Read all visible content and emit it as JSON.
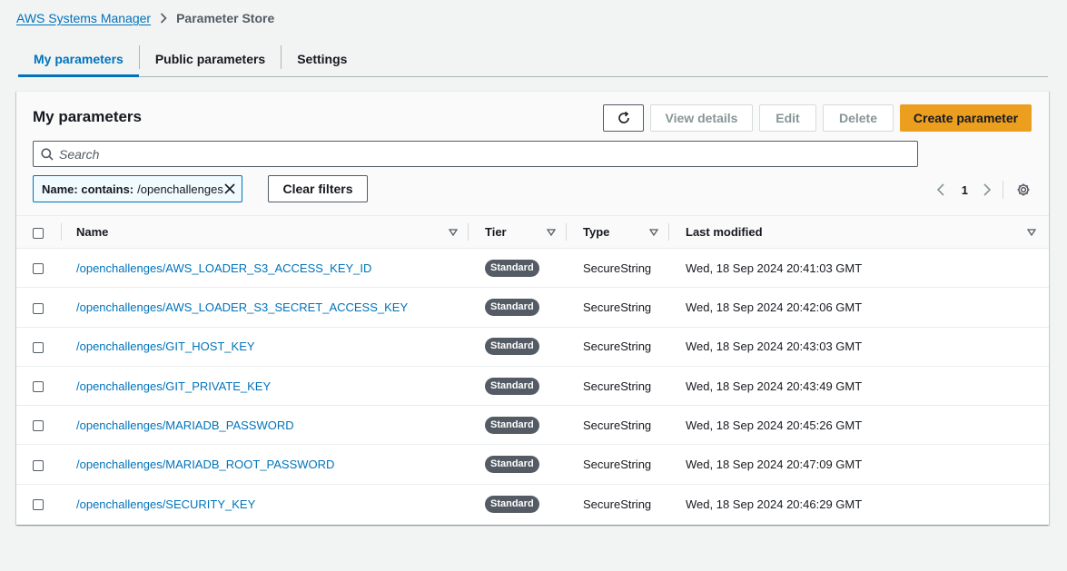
{
  "breadcrumb": {
    "parent": "AWS Systems Manager",
    "current": "Parameter Store"
  },
  "tabs": [
    {
      "label": "My parameters",
      "active": true
    },
    {
      "label": "Public parameters",
      "active": false
    },
    {
      "label": "Settings",
      "active": false
    }
  ],
  "panel": {
    "title": "My parameters",
    "buttons": {
      "refresh_icon": "refresh-icon",
      "view_details": "View details",
      "edit": "Edit",
      "delete": "Delete",
      "create": "Create parameter"
    },
    "search": {
      "placeholder": "Search",
      "value": ""
    },
    "filter_token": {
      "key": "Name: contains:",
      "value": "/openchallenges"
    },
    "clear_filters": "Clear filters",
    "pager": {
      "page": "1"
    }
  },
  "table": {
    "columns": [
      "Name",
      "Tier",
      "Type",
      "Last modified"
    ],
    "rows": [
      {
        "name": "/openchallenges/AWS_LOADER_S3_ACCESS_KEY_ID",
        "tier": "Standard",
        "type": "SecureString",
        "modified": "Wed, 18 Sep 2024 20:41:03 GMT"
      },
      {
        "name": "/openchallenges/AWS_LOADER_S3_SECRET_ACCESS_KEY",
        "tier": "Standard",
        "type": "SecureString",
        "modified": "Wed, 18 Sep 2024 20:42:06 GMT"
      },
      {
        "name": "/openchallenges/GIT_HOST_KEY",
        "tier": "Standard",
        "type": "SecureString",
        "modified": "Wed, 18 Sep 2024 20:43:03 GMT"
      },
      {
        "name": "/openchallenges/GIT_PRIVATE_KEY",
        "tier": "Standard",
        "type": "SecureString",
        "modified": "Wed, 18 Sep 2024 20:43:49 GMT"
      },
      {
        "name": "/openchallenges/MARIADB_PASSWORD",
        "tier": "Standard",
        "type": "SecureString",
        "modified": "Wed, 18 Sep 2024 20:45:26 GMT"
      },
      {
        "name": "/openchallenges/MARIADB_ROOT_PASSWORD",
        "tier": "Standard",
        "type": "SecureString",
        "modified": "Wed, 18 Sep 2024 20:47:09 GMT"
      },
      {
        "name": "/openchallenges/SECURITY_KEY",
        "tier": "Standard",
        "type": "SecureString",
        "modified": "Wed, 18 Sep 2024 20:46:29 GMT"
      }
    ]
  },
  "colors": {
    "link": "#0073bb",
    "primary_button": "#ec9f1f",
    "badge": "#545b64"
  }
}
